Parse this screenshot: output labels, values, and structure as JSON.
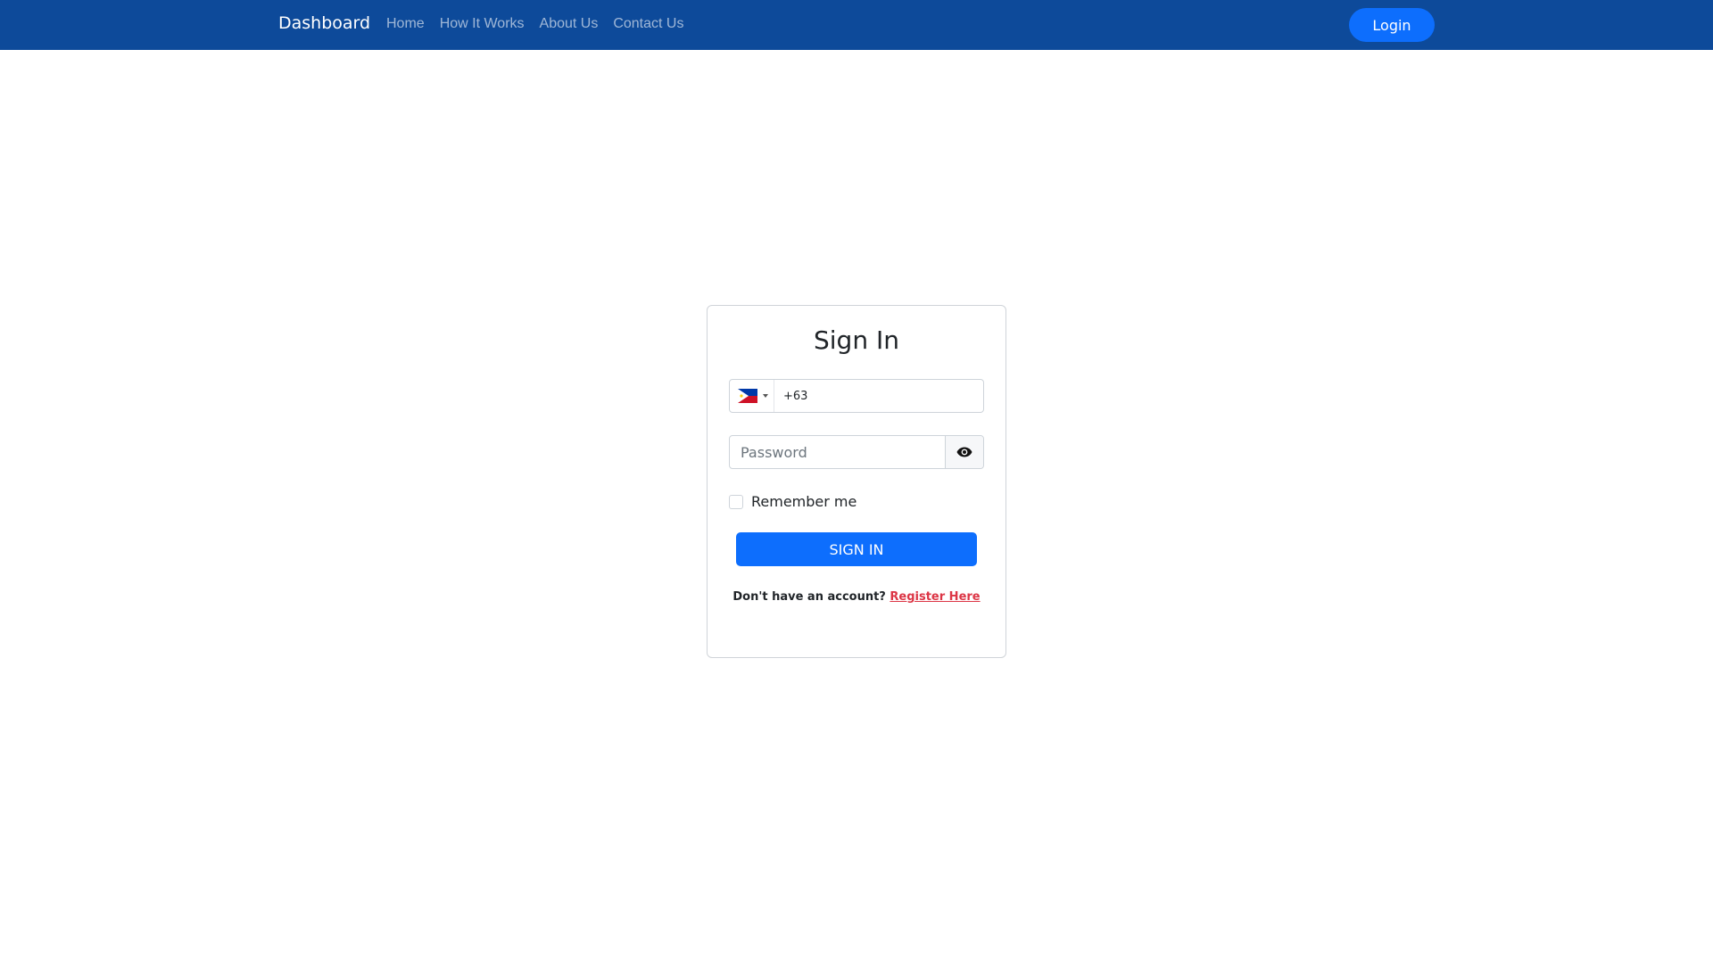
{
  "navbar": {
    "brand": "Dashboard",
    "links": [
      {
        "label": "Home"
      },
      {
        "label": "How It Works"
      },
      {
        "label": "About Us"
      },
      {
        "label": "Contact Us"
      }
    ],
    "login_label": "Login"
  },
  "signin": {
    "title": "Sign In",
    "phone": {
      "country_flag": "philippines-flag-icon",
      "value": "+63"
    },
    "password": {
      "placeholder": "Password",
      "toggle_icon": "eye-icon"
    },
    "remember_label": "Remember me",
    "submit_label": "SIGN IN",
    "register_prompt": "Don't have an account?",
    "register_link": "Register Here"
  },
  "colors": {
    "navbar_bg": "#0d4a9a",
    "primary": "#0d6efd",
    "link_red": "#dc3545"
  }
}
